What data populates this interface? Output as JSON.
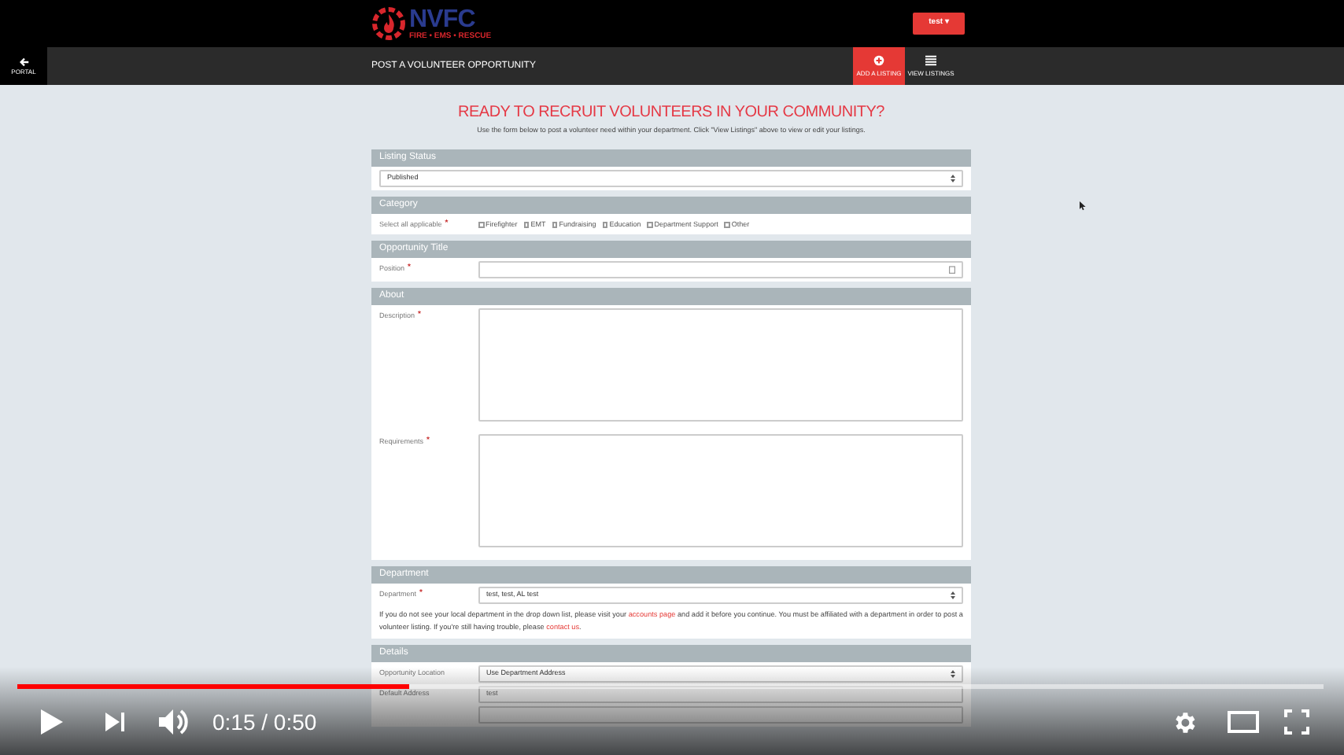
{
  "header": {
    "logo": "NVFC",
    "logo_tagline": "FIRE • EMS • RESCUE",
    "user_button": "test ▾"
  },
  "nav": {
    "back": "PORTAL",
    "title": "POST A VOLUNTEER OPPORTUNITY",
    "actions": [
      {
        "label": "ADD A LISTING",
        "selected": true,
        "kind": "add"
      },
      {
        "label": "VIEW LISTINGS",
        "selected": false,
        "kind": "list"
      }
    ]
  },
  "heading": "READY TO RECRUIT VOLUNTEERS IN YOUR COMMUNITY?",
  "intro": "Use the form below to post a volunteer need within your department. Click \"View Listings\" above to view or edit your listings.",
  "sections": [
    {
      "title": "Listing Status",
      "rows": [
        {
          "kind": "select",
          "value": "Published"
        }
      ]
    },
    {
      "title": "Category",
      "rows": [
        {
          "kind": "checkboxes",
          "label": "Select all applicable",
          "required_mark": "*",
          "options": [
            {
              "label": "Firefighter",
              "checked": false
            },
            {
              "label": "EMT",
              "checked": false
            },
            {
              "label": "Fundraising",
              "checked": false
            },
            {
              "label": "Education",
              "checked": false
            },
            {
              "label": "Department Support",
              "checked": false
            },
            {
              "label": "Other",
              "checked": false
            }
          ]
        }
      ]
    },
    {
      "title": "Opportunity Title",
      "rows": [
        {
          "kind": "text",
          "label": "Position",
          "required_mark": "*"
        }
      ]
    },
    {
      "title": "About",
      "rows": [
        {
          "kind": "textarea",
          "label": "Description",
          "required_mark": "*"
        },
        {
          "kind": "textarea",
          "label": "Requirements",
          "required_mark": "*"
        }
      ]
    },
    {
      "title": "Department",
      "rows": [
        {
          "kind": "select",
          "label": "Department",
          "required_mark": "*",
          "value": "test, test, AL test"
        },
        {
          "kind": "note",
          "text": "If you do not see your local department in the drop down list, please visit your ",
          "link1": "accounts page",
          "text2": " and add it before you continue. You must be affiliated with a department in order to post a volunteer listing. If you're still having trouble, please ",
          "link2": "contact us",
          "text3": "."
        }
      ]
    },
    {
      "title": "Details",
      "rows": [
        {
          "kind": "select",
          "label": "Opportunity Location",
          "value": "Use Department Address"
        },
        {
          "kind": "text",
          "label": "Default Address",
          "value": "test"
        },
        {
          "kind": "text"
        }
      ]
    }
  ],
  "player": {
    "progress": {
      "level": 0.3
    },
    "time": "0:15 / 0:50"
  }
}
